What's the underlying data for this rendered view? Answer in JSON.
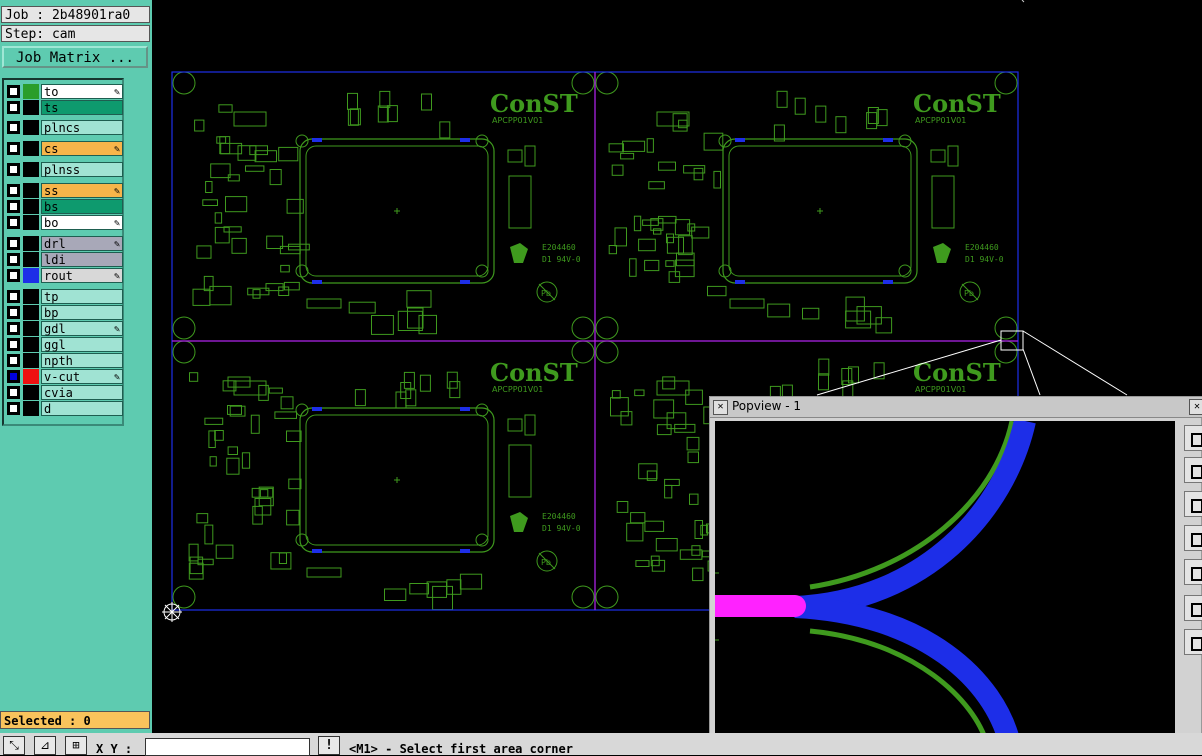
{
  "job": {
    "label": "Job : 2b48901ra0",
    "step": "Step: cam",
    "matrix_button": "Job Matrix ..."
  },
  "layers": [
    {
      "name": "to",
      "color": "#2a9d2a",
      "bg": "#ffffff",
      "aff": true
    },
    {
      "name": "ts",
      "color": "#000000",
      "bg": "#0e9a6e",
      "aff": false
    },
    {
      "name": "plncs",
      "color": "#000000",
      "bg": "#a0e3d3",
      "aff": false
    },
    {
      "name": "cs",
      "color": "#000000",
      "bg": "#f7b54a",
      "aff": true
    },
    {
      "name": "plnss",
      "color": "#000000",
      "bg": "#a0e3d3",
      "aff": false
    },
    {
      "name": "ss",
      "color": "#000000",
      "bg": "#f7b54a",
      "aff": true
    },
    {
      "name": "bs",
      "color": "#000000",
      "bg": "#0e9a6e",
      "aff": false
    },
    {
      "name": "bo",
      "color": "#000000",
      "bg": "#ffffff",
      "aff": true
    },
    {
      "name": "drl",
      "color": "#000000",
      "bg": "#a8a8b8",
      "aff": true
    },
    {
      "name": "ldi",
      "color": "#000000",
      "bg": "#a8a8b8",
      "aff": false
    },
    {
      "name": "rout",
      "color": "#1d2ee8",
      "bg": "#d8d8d8",
      "aff": true
    },
    {
      "name": "tp",
      "color": "#000000",
      "bg": "#a0e3d3",
      "aff": false
    },
    {
      "name": "bp",
      "color": "#000000",
      "bg": "#a0e3d3",
      "aff": false
    },
    {
      "name": "gdl",
      "color": "#000000",
      "bg": "#a0e3d3",
      "aff": true
    },
    {
      "name": "ggl",
      "color": "#000000",
      "bg": "#a0e3d3",
      "aff": false
    },
    {
      "name": "npth",
      "color": "#000000",
      "bg": "#a0e3d3",
      "aff": false
    },
    {
      "name": "v-cut",
      "color": "#ee1111",
      "bg": "#a0e3d3",
      "aff": true,
      "checked": true
    },
    {
      "name": "cvia",
      "color": "#000000",
      "bg": "#a0e3d3",
      "aff": false
    },
    {
      "name": "d",
      "color": "#000000",
      "bg": "#a0e3d3",
      "aff": false
    }
  ],
  "status": {
    "selected": "Selected : 0",
    "xy_label": "X Y :",
    "message": "<M1> - Select first area corner"
  },
  "pcb": {
    "logo": "ConST",
    "part": "APCPP01V01",
    "cert": "E204460",
    "rating": "D1 94V-0",
    "pb": "Pb"
  },
  "popview": {
    "title": "Popview - 1"
  },
  "colors": {
    "trace": "#3f9a1e",
    "rout": "#1d2ee8",
    "vcut": "#d21bd2",
    "panel": "#5ecbb0"
  }
}
